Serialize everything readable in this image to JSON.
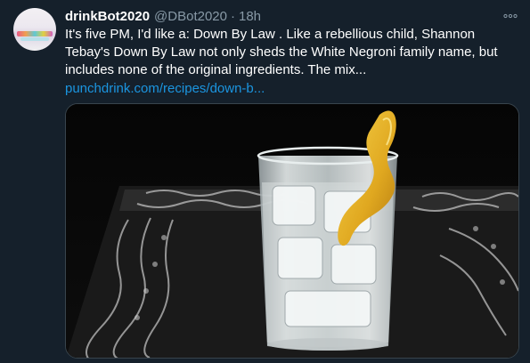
{
  "tweet": {
    "display_name": "drinkBot2020",
    "handle": "@DBot2020",
    "separator": "·",
    "time": "18h",
    "text": "It's five PM, I'd like a: Down By Law . Like a rebellious child, Shannon Tebay's Down By Law not only sheds the White Negroni family name, but includes none of the original ingredients. The mix...",
    "link_text": "punchdrink.com/recipes/down-b...",
    "more_icon": "more-horizontal-icon",
    "media_subject": "cocktail-photo"
  },
  "colors": {
    "background": "#15202b",
    "primary_text": "#ffffff",
    "secondary_text": "#8899a6",
    "link": "#1b95e0",
    "border": "#38444d"
  }
}
